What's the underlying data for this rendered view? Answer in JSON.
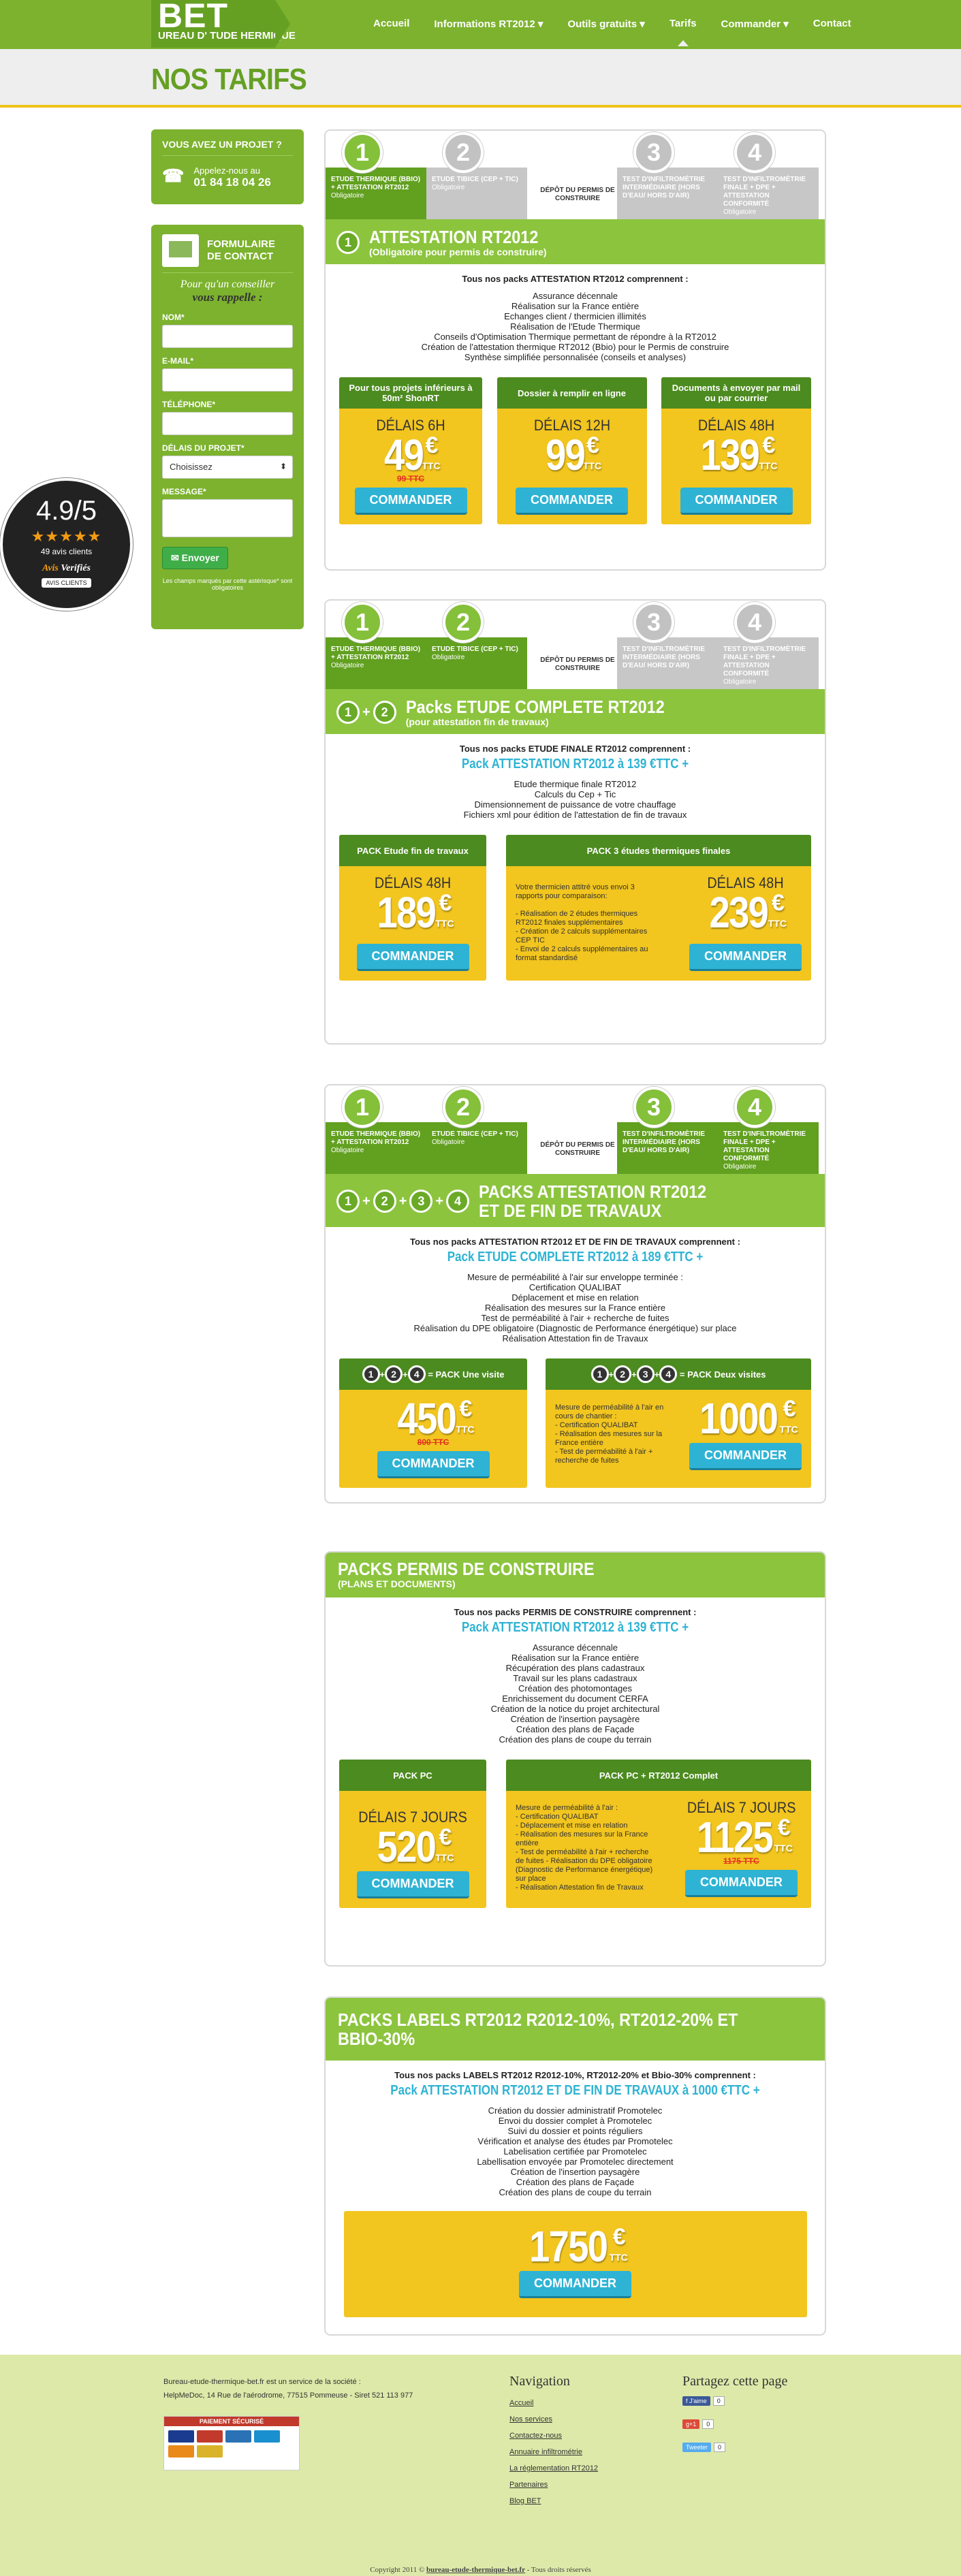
{
  "header": {
    "logo_big": "BET",
    "logo_small": "UREAU D'  TUDE  HERMIQUE",
    "nav": [
      "Accueil",
      "Informations RT2012 ▾",
      "Outils gratuits ▾",
      "Tarifs",
      "Commander ▾",
      "Contact"
    ]
  },
  "page_title": "NOS TARIFS",
  "rating": {
    "score": "4.9/5",
    "stars": "★★★★★",
    "count": "49 avis clients",
    "brand_a": "Avis",
    "brand_b": "Verifiés",
    "label": "AVIS CLIENTS"
  },
  "sidebar": {
    "project_title": "VOUS AVEZ UN PROJET ?",
    "call_label": "Appelez-nous au",
    "phone": "01 84 18 04 26",
    "form_title_1": "FORMULAIRE",
    "form_title_2": "DE CONTACT",
    "sub_1": "Pour qu'un conseiller",
    "sub_2": "vous rappelle :",
    "f_name": "NOM*",
    "f_email": "E-MAIL*",
    "f_phone": "TÉLÉPHONE*",
    "f_delay": "DÉLAIS DU PROJET*",
    "f_delay_value": "Choisissez",
    "f_msg": "MESSAGE*",
    "send": "Envoyer",
    "note": "Les champs marqués par cette astérisque* sont obligatoires"
  },
  "steps": {
    "s1": "ETUDE THERMIQUE (BBIO) + ATTESTATION RT2012",
    "s1o": "Obligatoire",
    "s2": "ETUDE TIBICE (CEP + TIC)",
    "s2o": "Obligatoire",
    "s3": "DÉPÔT DU PERMIS DE CONSTRUIRE",
    "s4": "TEST D'INFILTROMÈTRIE INTERMÉDIAIRE (HORS D'EAU/ HORS D'AIR)",
    "s5": "TEST D'INFILTROMÈTRIE FINALE + DPE + ATTESTATION CONFORMITÉ",
    "s5o": "Obligatoire"
  },
  "pkg1": {
    "title": "ATTESTATION RT2012",
    "sub": "(Obligatoire pour permis de construire)",
    "intro": "Tous nos packs ATTESTATION RT2012 comprennent :",
    "items": [
      "Assurance décennale",
      "Réalisation sur la France entière",
      "Echanges client / thermicien illimités",
      "Réalisation de l'Etude Thermique",
      "Conseils d'Optimisation Thermique permettant de répondre à la RT2012",
      "Création de l'attestation thermique RT2012 (Bbio) pour le Permis de construire",
      "Synthèse simplifiée personnalisée (conseils et analyses)"
    ],
    "offers": [
      {
        "head": "Pour tous projets inférieurs à 50m² ShonRT",
        "delay": "DÉLAIS 6H",
        "price": "49",
        "old": "99 TTC"
      },
      {
        "head": "Dossier à remplir en ligne",
        "delay": "DÉLAIS 12H",
        "price": "99",
        "old": ""
      },
      {
        "head": "Documents à envoyer par mail ou par courrier",
        "delay": "DÉLAIS 48H",
        "price": "139",
        "old": ""
      }
    ]
  },
  "pkg2": {
    "title": "Packs ETUDE COMPLETE RT2012",
    "sub": "(pour attestation fin de travaux)",
    "intro": "Tous nos packs ETUDE FINALE RT2012 comprennent :",
    "plus": "Pack ATTESTATION RT2012 à 139 €TTC +",
    "items": [
      "Etude thermique finale RT2012",
      "Calculs du Cep + Tic",
      "Dimensionnement de puissance de votre chauffage",
      "Fichiers xml pour édition de l'attestation de fin de travaux"
    ],
    "o1_head": "PACK Etude fin de travaux",
    "o1_delay": "DÉLAIS 48H",
    "o1_price": "189",
    "o2_head": "PACK 3 études thermiques finales",
    "o2_text": "Votre thermicien attitré vous envoi 3 rapports pour comparaison:\n\n- Réalisation de 2 études thermiques RT2012 finales supplémentaires\n- Création de 2 calculs supplémentaires CEP TIC\n- Envoi de 2 calculs supplémentaires au format standardisé",
    "o2_delay": "DÉLAIS 48H",
    "o2_price": "239"
  },
  "pkg3": {
    "title_1": "PACKS ATTESTATION RT2012",
    "title_2": "ET DE FIN DE TRAVAUX",
    "intro": "Tous nos packs ATTESTATION RT2012 ET DE FIN DE TRAVAUX comprennent :",
    "plus": "Pack ETUDE COMPLETE RT2012 à 189 €TTC +",
    "items": [
      "Mesure de perméabilité à l'air sur enveloppe terminée :",
      "Certification QUALIBAT",
      "Déplacement et mise en relation",
      "Réalisation des mesures sur la France entière",
      "Test de perméabilité à l'air + recherche de fuites",
      "Réalisation du DPE obligatoire (Diagnostic de Performance énergétique) sur place",
      "Réalisation Attestation fin de Travaux"
    ],
    "o1_head": "= PACK Une visite",
    "o1_price": "450",
    "o1_old": "800 TTC",
    "o2_head": "= PACK Deux visites",
    "o2_text": "Mesure de perméabilité à l'air en cours de chantier :\n- Certification QUALIBAT\n- Réalisation des mesures sur la France entière\n- Test de perméabilité à l'air + recherche de fuites",
    "o2_price": "1000"
  },
  "pkg4": {
    "title": "PACKS PERMIS DE CONSTRUIRE",
    "sub": "(PLANS ET DOCUMENTS)",
    "intro": "Tous nos packs PERMIS DE CONSTRUIRE comprennent :",
    "plus": "Pack ATTESTATION RT2012 à 139 €TTC +",
    "items": [
      "Assurance décennale",
      "Réalisation sur la France entière",
      "Récupération des plans cadastraux",
      "Travail sur les plans cadastraux",
      "Création des photomontages",
      "Enrichissement du document CERFA",
      "Création de la notice du projet architectural",
      "Création de l'insertion paysagère",
      "Création des plans de Façade",
      "Création des plans de coupe du terrain"
    ],
    "o1_head": "PACK PC",
    "o1_delay": "DÉLAIS 7 JOURS",
    "o1_price": "520",
    "o2_head": "PACK PC + RT2012 Complet",
    "o2_text": "Mesure de perméabilité à l'air :\n- Certification QUALIBAT\n- Déplacement et mise en relation\n- Réalisation des mesures sur la France entière\n- Test de perméabilité à l'air + recherche de fuites - Réalisation du DPE obligatoire (Diagnostic de Performance énergétique) sur place\n- Réalisation Attestation fin de Travaux",
    "o2_delay": "DÉLAIS 7 JOURS",
    "o2_price": "1125",
    "o2_old": "1175 TTC"
  },
  "pkg5": {
    "title": "PACKS LABELS RT2012 R2012-10%, RT2012-20% ET BBIO-30%",
    "intro": "Tous nos packs LABELS RT2012 R2012-10%, RT2012-20% et Bbio-30% comprennent :",
    "plus": "Pack ATTESTATION RT2012 ET DE FIN DE TRAVAUX à 1000 €TTC +",
    "items": [
      "Création du dossier administratif Promotelec",
      "Envoi du dossier complet à Promotelec",
      "Suivi du dossier et points réguliers",
      "Vérification et analyse des études par Promotelec",
      "Labelisation certifiée par Promotelec",
      "Labellisation envoyée par Promotelec directement",
      "Création de l'insertion paysagère",
      "Création des plans de Façade",
      "Création des plans de coupe du terrain"
    ],
    "price": "1750"
  },
  "common": {
    "euro": "€",
    "ttc": "TTC",
    "cta": "COMMANDER",
    "plus_sign": "+"
  },
  "footer": {
    "l1": "Bureau-etude-thermique-bet.fr est un service de la société :",
    "l2": "HelpMeDoc, 14 Rue de l'aérodrome, 77515 Pommeuse - Siret 521 113 977",
    "pay": "PAIEMENT SÉCURISÉ",
    "nav_title": "Navigation",
    "nav": [
      "Accueil",
      "Nos services",
      "Contactez-nous",
      "Annuaire infiltrométrie",
      "La réglementation RT2012",
      "Partenaires",
      "Blog BET"
    ],
    "share_title": "Partagez cette page",
    "fb": "f J'aime",
    "fb_n": "0",
    "gp": "g+1",
    "gp_n": "0",
    "tw": "Tweeter",
    "tw_n": "0",
    "copy_a": "Copyright 2011 ©",
    "copy_b": "bureau-etude-thermique-bet.fr",
    "copy_c": "- Tous droits réservés"
  }
}
